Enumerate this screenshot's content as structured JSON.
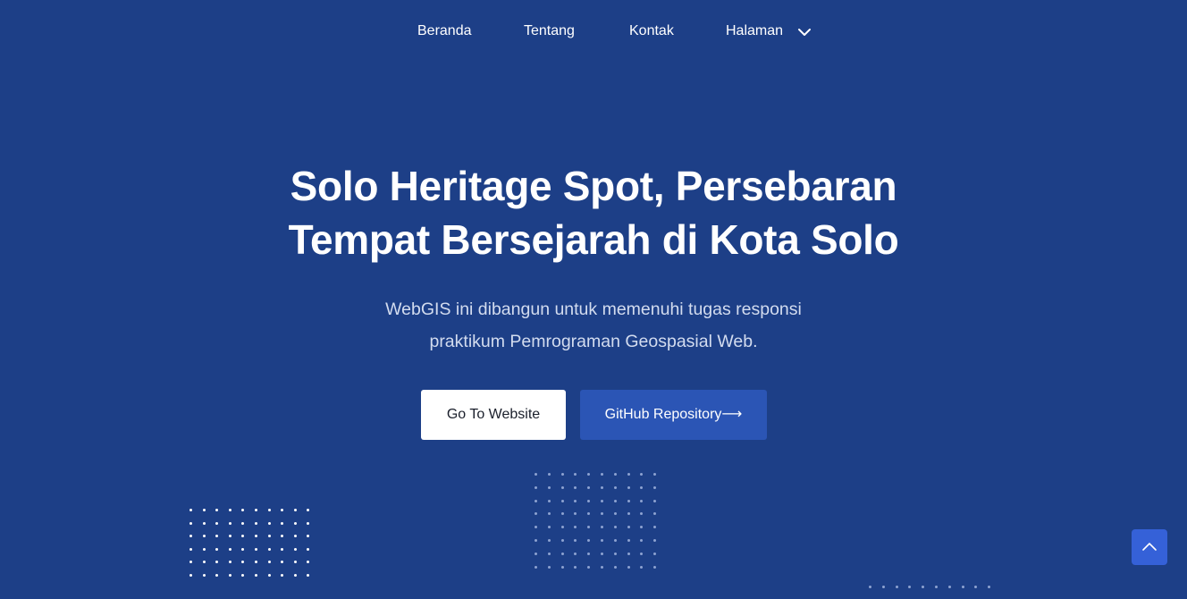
{
  "nav": {
    "items": [
      {
        "label": "Beranda"
      },
      {
        "label": "Tentang"
      },
      {
        "label": "Kontak"
      },
      {
        "label": "Halaman",
        "icon": "chevron-down-icon"
      }
    ]
  },
  "hero": {
    "title_lines": [
      "Solo Heritage Spot, Persebaran",
      "Tempat Bersejarah di Kota Solo"
    ],
    "description_lines": [
      "WebGIS ini dibangun untuk memenuhi tugas responsi",
      "praktikum Pemrograman Geospasial Web."
    ],
    "primary_button": "Go To Website",
    "secondary_button": "GitHub Repository⟶"
  },
  "back_to_top": {
    "icon": "chevron-up-icon"
  },
  "colors": {
    "background": "#1d3f87",
    "primary_button_bg": "#ffffff",
    "secondary_button_bg": "#2b55b5",
    "back_to_top_bg": "#3561d8",
    "description_text": "#d3dcef"
  }
}
